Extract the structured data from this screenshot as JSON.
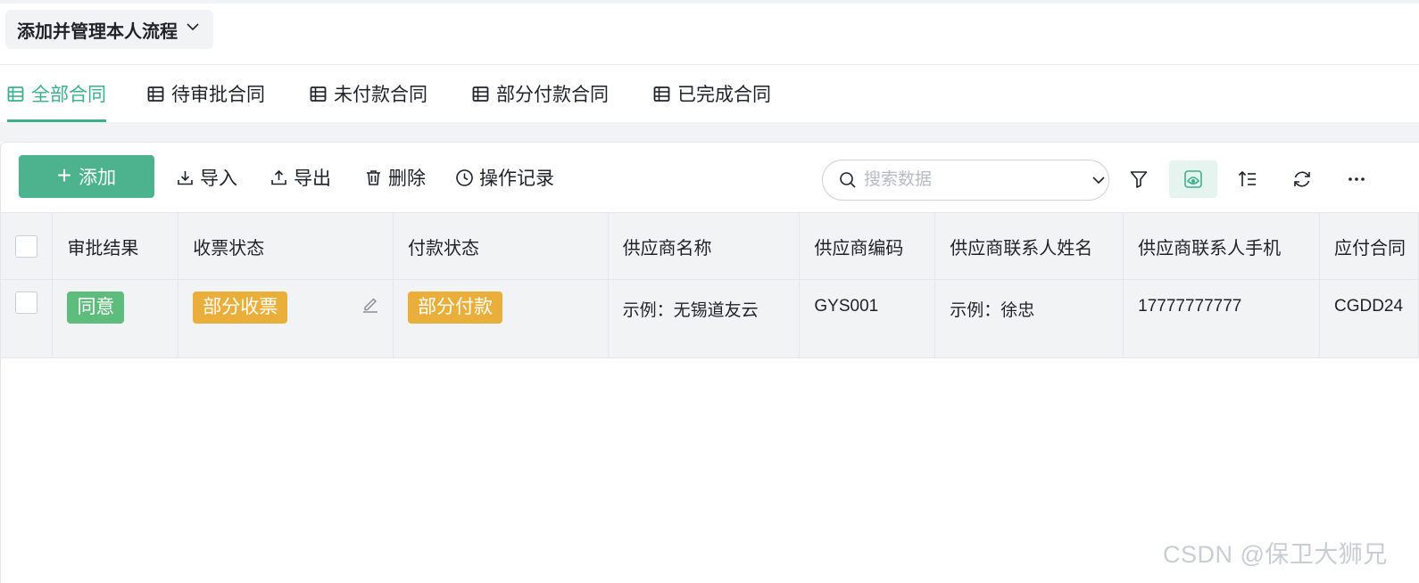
{
  "header": {
    "flow_label": "添加并管理本人流程"
  },
  "tabs": [
    {
      "label": "全部合同",
      "active": true
    },
    {
      "label": "待审批合同",
      "active": false
    },
    {
      "label": "未付款合同",
      "active": false
    },
    {
      "label": "部分付款合同",
      "active": false
    },
    {
      "label": "已完成合同",
      "active": false
    }
  ],
  "toolbar": {
    "add_label": "添加",
    "import_label": "导入",
    "export_label": "导出",
    "delete_label": "删除",
    "log_label": "操作记录",
    "search_placeholder": "搜索数据"
  },
  "table": {
    "columns": [
      "审批结果",
      "收票状态",
      "付款状态",
      "供应商名称",
      "供应商编码",
      "供应商联系人姓名",
      "供应商联系人手机",
      "应付合同"
    ],
    "rows": [
      {
        "approval": "同意",
        "invoice_status": "部分收票",
        "payment_status": "部分付款",
        "supplier_name": "示例：无锡道友云",
        "supplier_code": "GYS001",
        "contact_name": "示例：徐忠",
        "contact_phone": "17777777777",
        "contract_no": "CGDD24"
      }
    ]
  },
  "colors": {
    "accent": "#3cb08a",
    "add_button": "#4db38f",
    "tag_green": "#5ebc7c",
    "tag_orange": "#eaae3b"
  },
  "watermark": "CSDN @保卫大狮兄"
}
